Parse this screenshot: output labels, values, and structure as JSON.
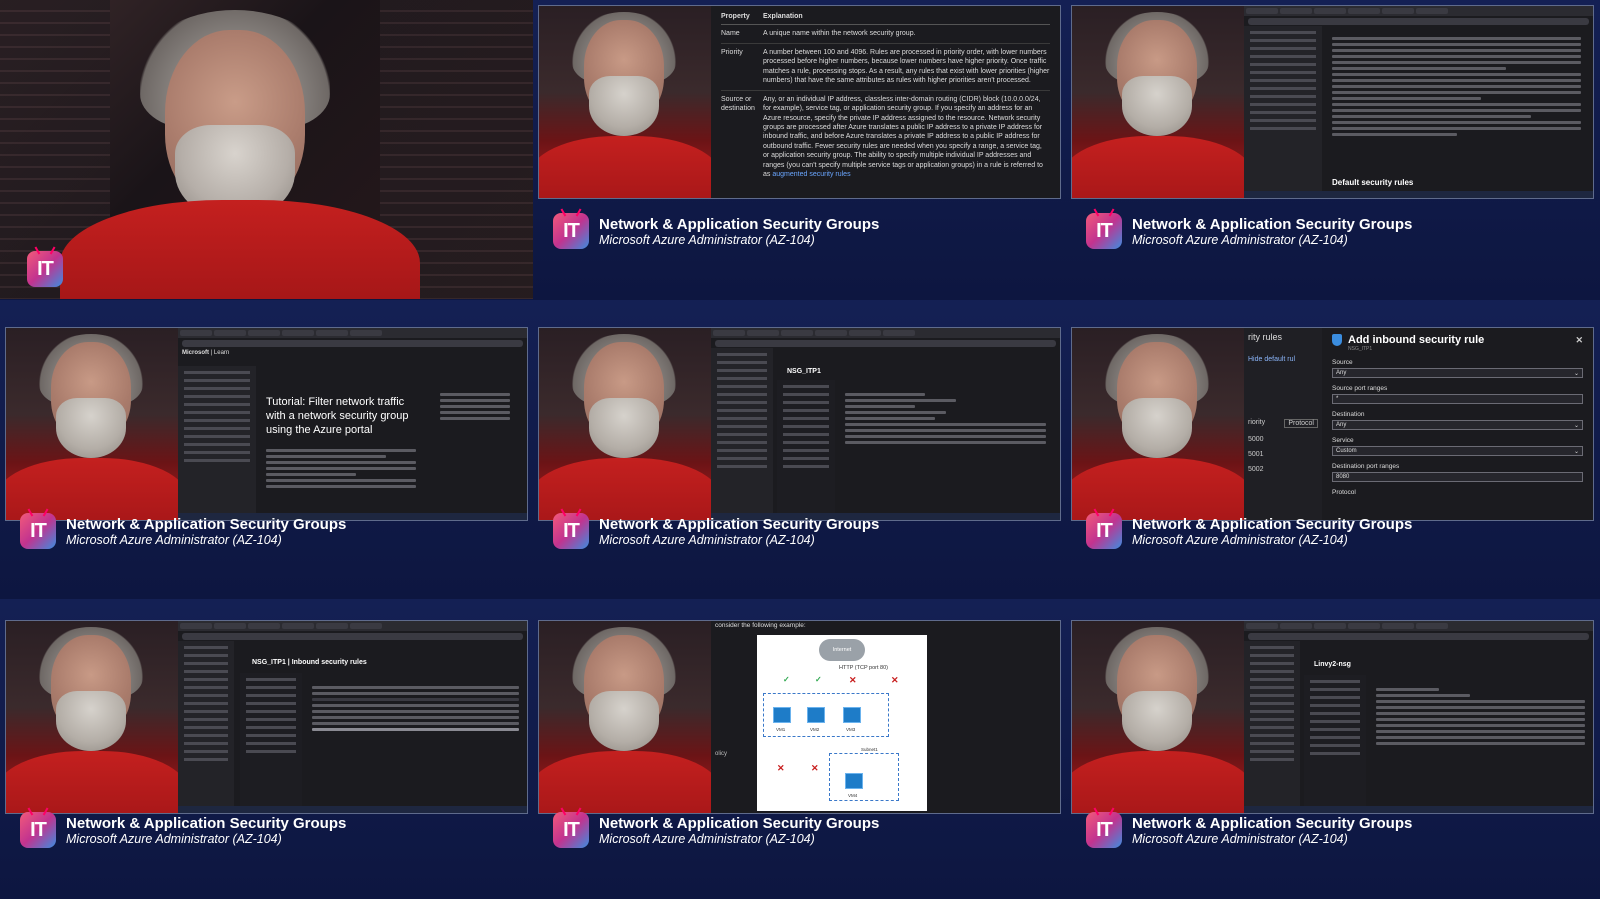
{
  "caption": {
    "title": "Network & Application Security Groups",
    "subtitle": "Microsoft Azure Administrator (AZ-104)"
  },
  "brand": {
    "logo_text": "IT"
  },
  "tile2_table": {
    "header": [
      "Property",
      "Explanation"
    ],
    "rows": [
      {
        "prop": "Name",
        "text": "A unique name within the network security group."
      },
      {
        "prop": "Priority",
        "text": "A number between 100 and 4096. Rules are processed in priority order, with lower numbers processed before higher numbers, because lower numbers have higher priority. Once traffic matches a rule, processing stops. As a result, any rules that exist with lower priorities (higher numbers) that have the same attributes as rules with higher priorities aren't processed."
      },
      {
        "prop": "Source or destination",
        "text": "Any, or an individual IP address, classless inter-domain routing (CIDR) block (10.0.0.0/24, for example), service tag, or application security group. If you specify an address for an Azure resource, specify the private IP address assigned to the resource. Network security groups are processed after Azure translates a public IP address to a private IP address for inbound traffic, and before Azure translates a private IP address to a public IP address for outbound traffic. Fewer security rules are needed when you specify a range, a service tag, or application security group. The ability to specify multiple individual IP addresses and ranges (you can't specify multiple service tags or application groups) in a rule is referred to as",
        "link": "augmented security rules"
      }
    ]
  },
  "tile3": {
    "heading": "Default security rules"
  },
  "tile4": {
    "tutorial_title": "Tutorial: Filter network traffic with a network security group using the Azure portal",
    "brand": "Microsoft",
    "nav": "Learn"
  },
  "tile5": {
    "resource": "NSG_ITP1"
  },
  "tile6": {
    "left_text": "rity rules",
    "hide_default": "Hide default rul",
    "priority_label": "riority",
    "priorities": [
      "5000",
      "5001",
      "5002"
    ],
    "protocol_btn": "Protocol",
    "panel_title": "Add inbound security rule",
    "panel_sub": "NSG_ITP1",
    "fields": [
      {
        "label": "Source",
        "value": "Any"
      },
      {
        "label": "Source port ranges",
        "value": "*"
      },
      {
        "label": "Destination",
        "value": "Any"
      },
      {
        "label": "Service",
        "value": "Custom"
      },
      {
        "label": "Destination port ranges",
        "value": "8080"
      },
      {
        "label": "Protocol",
        "value": ""
      }
    ]
  },
  "tile7": {
    "title": "NSG_ITP1 | Inbound security rules"
  },
  "tile8": {
    "intro": "consider the following example:",
    "cloud": "Internet",
    "traffic": "HTTP (TCP port 80)",
    "vms": [
      "VM1",
      "VM2",
      "VM3",
      "VM4"
    ],
    "subnet": "Subnet1",
    "side_word": "olicy"
  },
  "tile9": {
    "resource": "Linvy2-nsg"
  }
}
